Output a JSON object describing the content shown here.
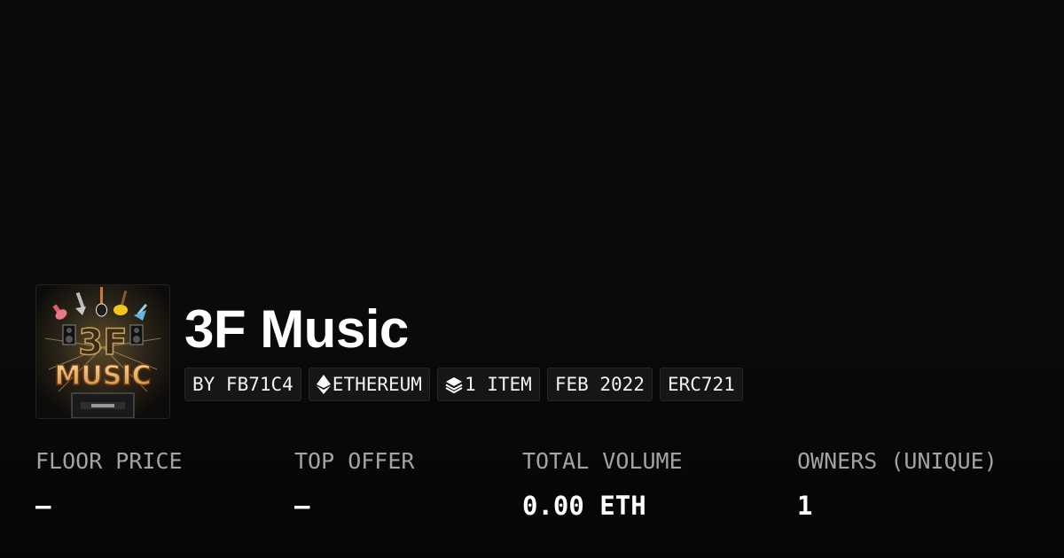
{
  "collection": {
    "title": "3F Music",
    "image_alt": "3F Music collection artwork",
    "image_text_top": "3F",
    "image_text_bottom": "MUSIC"
  },
  "chips": [
    {
      "icon": "",
      "label": "BY FB71C4"
    },
    {
      "icon": "ethereum-icon",
      "label": "ETHEREUM"
    },
    {
      "icon": "layers-icon",
      "label": "1 ITEM"
    },
    {
      "icon": "",
      "label": "FEB 2022"
    },
    {
      "icon": "",
      "label": "ERC721"
    }
  ],
  "stats": [
    {
      "label": "FLOOR PRICE",
      "value": "—"
    },
    {
      "label": "TOP OFFER",
      "value": "—"
    },
    {
      "label": "TOTAL VOLUME",
      "value": "0.00 ETH"
    },
    {
      "label": "OWNERS (UNIQUE)",
      "value": "1"
    }
  ],
  "colors": {
    "background": "#0b0b0b",
    "chip_background": "#161616",
    "label_gray": "#a3a3a3",
    "text_white": "#ffffff",
    "image_gold": "#e8b25a"
  }
}
